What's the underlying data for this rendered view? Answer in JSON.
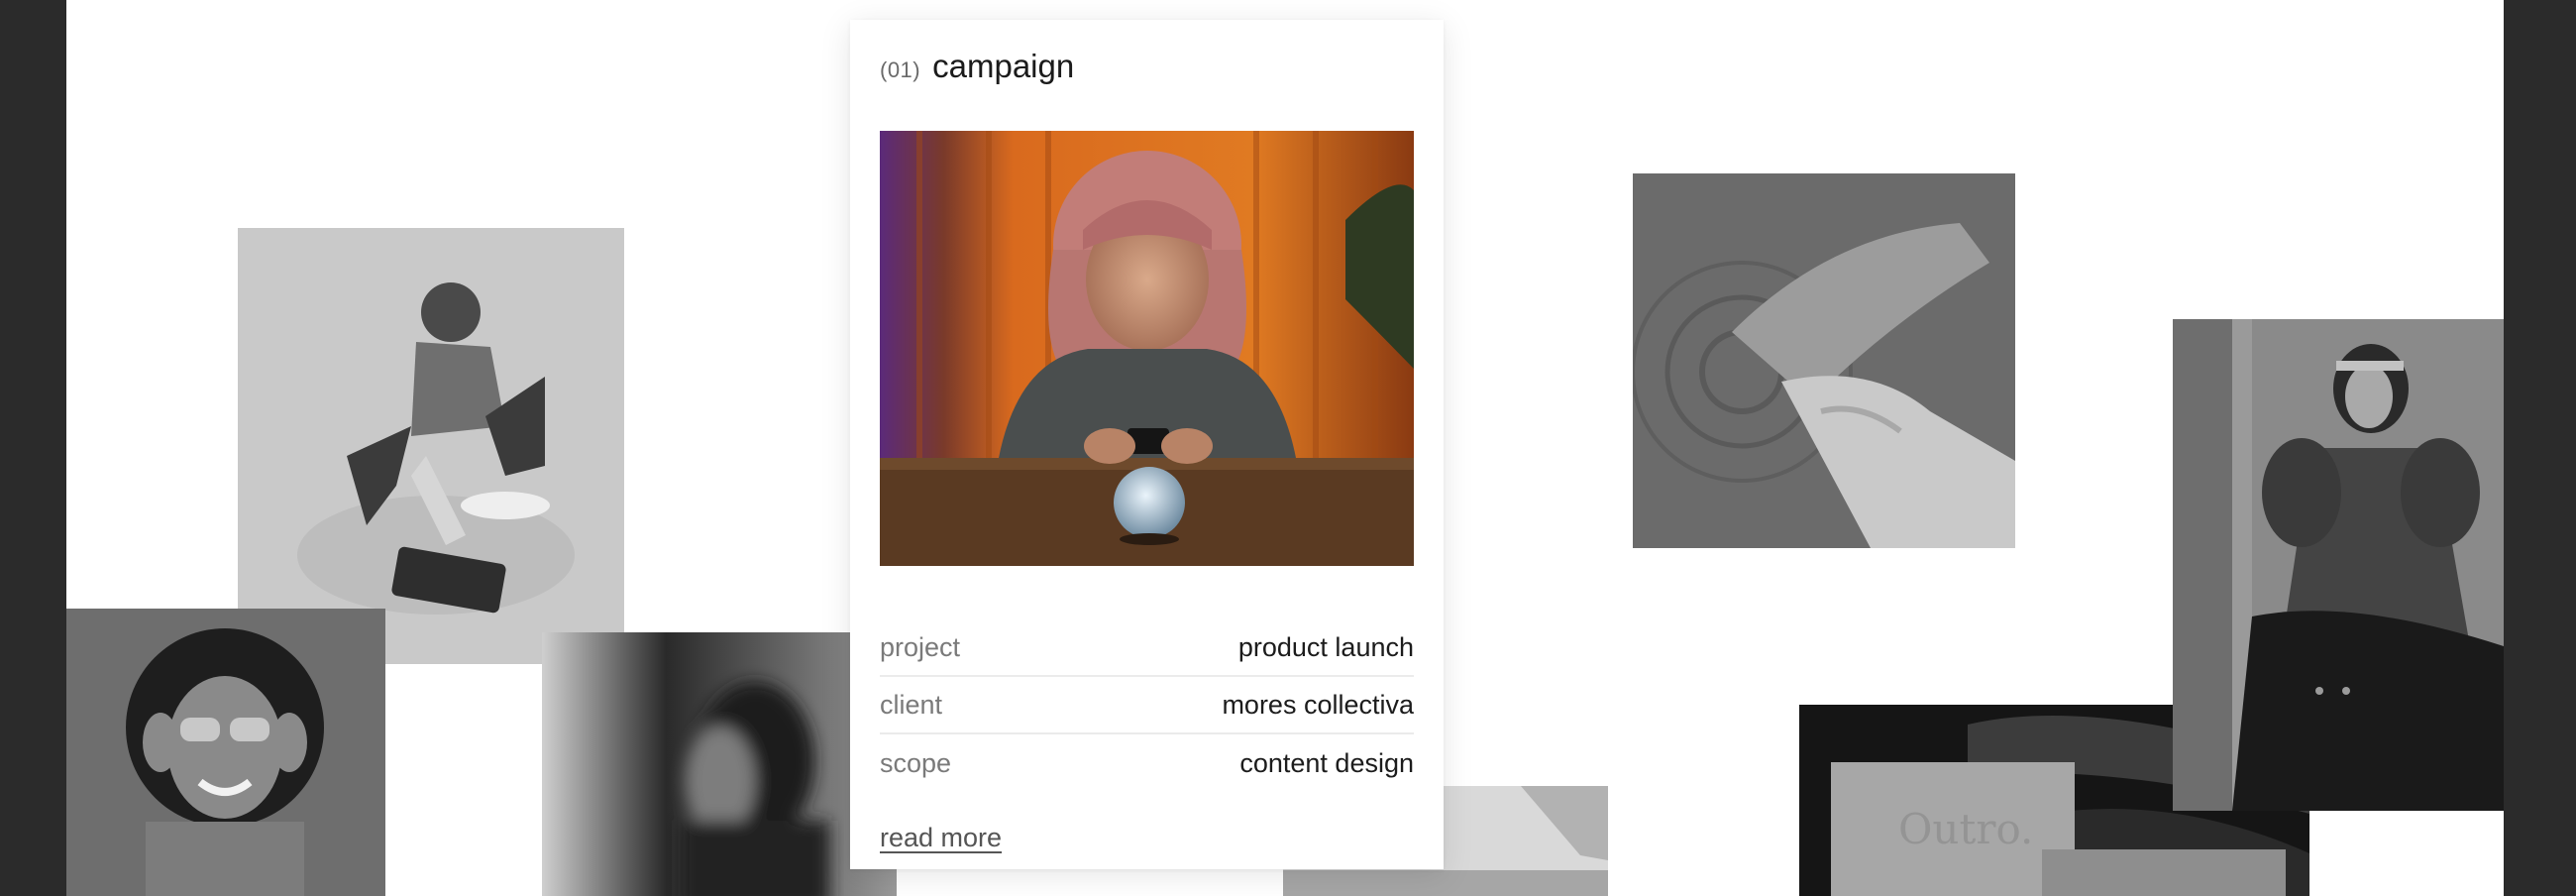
{
  "card": {
    "index": "(01)",
    "title": "campaign",
    "meta": [
      {
        "key": "project",
        "value": "product launch"
      },
      {
        "key": "client",
        "value": "mores collectiva"
      },
      {
        "key": "scope",
        "value": "content design"
      }
    ],
    "link_label": "read more"
  },
  "collage": {
    "brand_stamp": "Outro."
  },
  "colors": {
    "frame": "#2b2b2b",
    "stage": "#ffffff",
    "accent_orange": "#d96a1e",
    "muted_text": "#7a7a7a"
  }
}
